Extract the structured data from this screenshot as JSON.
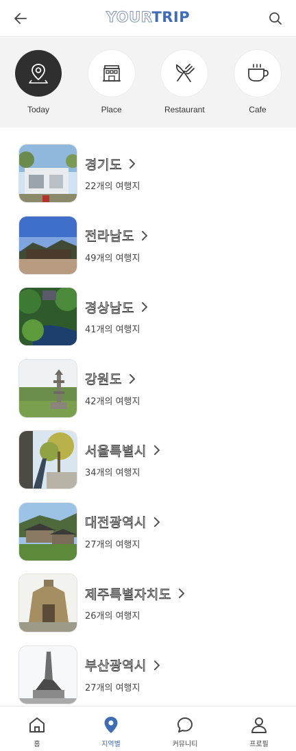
{
  "header": {
    "logo_part1": "YOUR",
    "logo_part2": "TRIP",
    "back_icon": "arrow-left-icon",
    "search_icon": "search-icon"
  },
  "categories": [
    {
      "label": "Today",
      "icon": "location-pin-icon",
      "active": true
    },
    {
      "label": "Place",
      "icon": "building-icon",
      "active": false
    },
    {
      "label": "Restaurant",
      "icon": "fork-knife-icon",
      "active": false
    },
    {
      "label": "Cafe",
      "icon": "coffee-cup-icon",
      "active": false
    }
  ],
  "regions": [
    {
      "name": "경기도",
      "count": "22개의 여행지"
    },
    {
      "name": "전라남도",
      "count": "49개의 여행지"
    },
    {
      "name": "경상남도",
      "count": "41개의 여행지"
    },
    {
      "name": "강원도",
      "count": "42개의 여행지"
    },
    {
      "name": "서울특별시",
      "count": "34개의 여행지"
    },
    {
      "name": "대전광역시",
      "count": "27개의 여행지"
    },
    {
      "name": "제주특별자치도",
      "count": "26개의 여행지"
    },
    {
      "name": "부산광역시",
      "count": "27개의 여행지"
    }
  ],
  "bottom_nav": [
    {
      "label": "홈",
      "icon": "home-icon",
      "active": false
    },
    {
      "label": "지역별",
      "icon": "location-pin-icon",
      "active": true
    },
    {
      "label": "커뮤니티",
      "icon": "chat-bubble-icon",
      "active": false
    },
    {
      "label": "프로필",
      "icon": "user-icon",
      "active": false
    }
  ],
  "colors": {
    "accent": "#3f6cb5",
    "active_category": "#2f2f2f",
    "category_bg": "#f3f3f3"
  }
}
